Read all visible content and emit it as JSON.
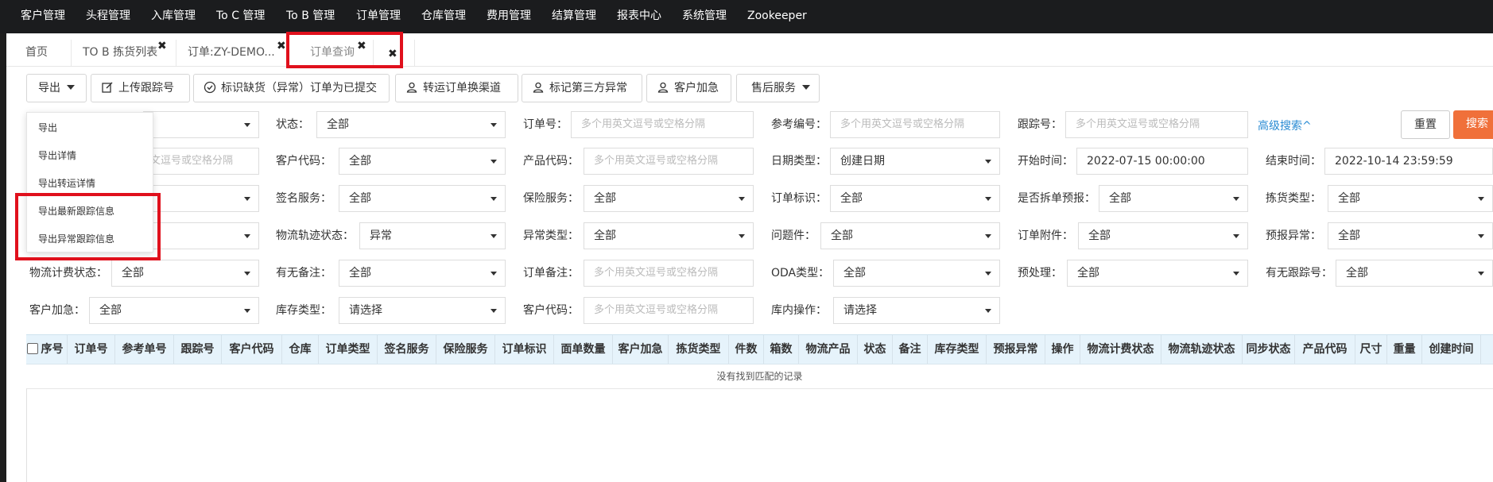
{
  "topnav": [
    "客户管理",
    "头程管理",
    "入库管理",
    "To C 管理",
    "To B 管理",
    "订单管理",
    "仓库管理",
    "费用管理",
    "结算管理",
    "报表中心",
    "系统管理",
    "Zookeeper"
  ],
  "tabs": [
    {
      "label": "首页"
    },
    {
      "label": "TO B 拣货列表"
    },
    {
      "label": "订单:ZY-DEMO..."
    },
    {
      "label": "订单查询"
    }
  ],
  "toolbar": {
    "export": "导出",
    "upload_tracking": "上传跟踪号",
    "mark_shortage": "标识缺货（异常）订单为已提交",
    "switch_channel": "转运订单换渠道",
    "mark_third_party": "标记第三方异常",
    "customer_urgent": "客户加急",
    "after_sales": "售后服务"
  },
  "export_menu": [
    "导出",
    "导出详情",
    "导出转运详情",
    "导出最新跟踪信息",
    "导出异常跟踪信息"
  ],
  "filters": {
    "status": {
      "label": "状态：",
      "value": "全部"
    },
    "order_no": {
      "label": "订单号：",
      "placeholder": "多个用英文逗号或空格分隔"
    },
    "ref_no": {
      "label": "参考编号：",
      "placeholder": "多个用英文逗号或空格分隔"
    },
    "tracking_no": {
      "label": "跟踪号：",
      "placeholder": "多个用英文逗号或空格分隔"
    },
    "advanced": "高级搜索^",
    "reset": "重置",
    "search": "搜索",
    "row2_partial_placeholder": "文逗号或空格分隔",
    "customer_code": {
      "label": "客户代码：",
      "value": "全部"
    },
    "product_code": {
      "label": "产品代码：",
      "placeholder": "多个用英文逗号或空格分隔"
    },
    "date_type": {
      "label": "日期类型：",
      "value": "创建日期"
    },
    "start_time": {
      "label": "开始时间：",
      "value": "2022-07-15 00:00:00"
    },
    "end_time": {
      "label": "结束时间：",
      "value": "2022-10-14 23:59:59"
    },
    "sign_service": {
      "label": "签名服务：",
      "value": "全部"
    },
    "insurance": {
      "label": "保险服务：",
      "value": "全部"
    },
    "order_flag": {
      "label": "订单标识：",
      "value": "全部"
    },
    "split_pre": {
      "label": "是否拆单预报：",
      "value": "全部"
    },
    "pick_type": {
      "label": "拣货类型：",
      "value": "全部"
    },
    "logistics_track": {
      "label": "物流轨迹状态：",
      "value": "异常"
    },
    "exception_type": {
      "label": "异常类型：",
      "value": "全部"
    },
    "problem_item": {
      "label": "问题件：",
      "value": "全部"
    },
    "order_attach": {
      "label": "订单附件：",
      "value": "全部"
    },
    "pre_exception": {
      "label": "预报异常：",
      "value": "全部"
    },
    "logistics_fee": {
      "label": "物流计费状态：",
      "value": "全部"
    },
    "has_remark": {
      "label": "有无备注：",
      "value": "全部"
    },
    "order_remark": {
      "label": "订单备注：",
      "placeholder": "多个用英文逗号或空格分隔"
    },
    "oda_type": {
      "label": "ODA类型：",
      "value": "全部"
    },
    "preprocess": {
      "label": "预处理：",
      "value": "全部"
    },
    "has_tracking": {
      "label": "有无跟踪号：",
      "value": "全部"
    },
    "customer_urgent": {
      "label": "客户加急：",
      "value": "全部"
    },
    "stock_type": {
      "label": "库存类型：",
      "value": "请选择"
    },
    "customer_code2": {
      "label": "客户代码：",
      "placeholder": "多个用英文逗号或空格分隔"
    },
    "warehouse_op": {
      "label": "库内操作：",
      "value": "请选择"
    }
  },
  "table": {
    "columns": [
      "序号",
      "订单号",
      "参考单号",
      "跟踪号",
      "客户代码",
      "仓库",
      "订单类型",
      "签名服务",
      "保险服务",
      "订单标识",
      "面单数量",
      "客户加急",
      "拣货类型",
      "件数",
      "箱数",
      "物流产品",
      "状态",
      "备注",
      "库存类型",
      "预报异常",
      "操作",
      "物流计费状态",
      "物流轨迹状态",
      "同步状态",
      "产品代码",
      "尺寸",
      "重量",
      "创建时间"
    ],
    "empty_text": "没有找到匹配的记录"
  },
  "colors": {
    "topnav": "#1b1c1e",
    "accent": "#f0703a",
    "highlight": "#e0101c",
    "header_bg": "#e6f3fb",
    "link": "#2a8bd3"
  }
}
